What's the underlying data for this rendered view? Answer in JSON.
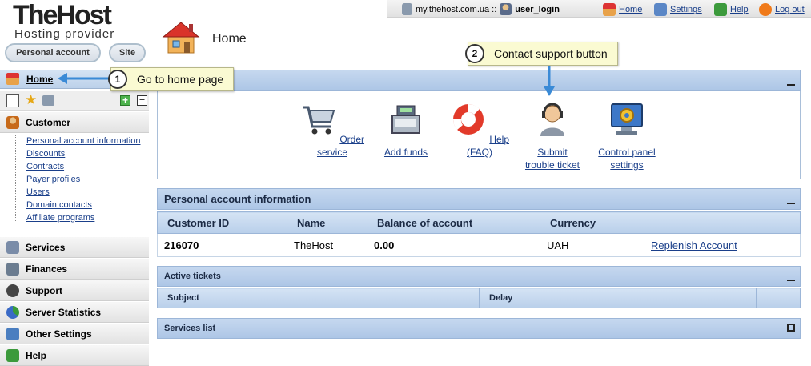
{
  "logo": {
    "brand": "TheHost",
    "tagline": "Hosting provider"
  },
  "top_tabs": {
    "personal": "Personal account",
    "site": "Site"
  },
  "topbar": {
    "domain": "my.thehost.com.ua ::",
    "user": "user_login",
    "home": "Home",
    "settings": "Settings",
    "help": "Help",
    "logout": "Log out"
  },
  "page_title": "Home",
  "sidebar": {
    "home": "Home",
    "customer": "Customer",
    "customer_items": [
      "Personal account information",
      "Discounts",
      "Contracts",
      "Payer profiles",
      "Users",
      "Domain contacts",
      "Affiliate programs"
    ],
    "sections": [
      "Services",
      "Finances",
      "Support",
      "Server Statistics",
      "Other Settings",
      "Help"
    ]
  },
  "quick_actions": [
    {
      "line1": "Order service",
      "line2": "",
      "icon": "cart-icon"
    },
    {
      "line1": "Add funds",
      "line2": "",
      "icon": "cash-register-icon"
    },
    {
      "line1": "Help (FAQ)",
      "line2": "",
      "icon": "lifebuoy-icon"
    },
    {
      "line1": "Submit",
      "line2": "trouble ticket",
      "icon": "support-agent-icon"
    },
    {
      "line1": "Control panel",
      "line2": "settings",
      "icon": "monitor-gear-icon"
    }
  ],
  "account_panel": {
    "title": "Personal account information",
    "headers": [
      "Customer ID",
      "Name",
      "Balance of account",
      "Currency",
      ""
    ],
    "row": {
      "id": "216070",
      "name": "TheHost",
      "balance": "0.00",
      "currency": "UAH",
      "action": "Replenish Account"
    }
  },
  "tickets_panel": {
    "title": "Active tickets",
    "headers": [
      "Subject",
      "Delay"
    ]
  },
  "services_panel": {
    "title": "Services list"
  },
  "callouts": [
    {
      "num": "1",
      "text": "Go to home page"
    },
    {
      "num": "2",
      "text": "Contact support button"
    }
  ],
  "colors": {
    "panel_blue": "#b9cfea",
    "link": "#1a3f8a",
    "callout_bg": "#fafad2"
  }
}
